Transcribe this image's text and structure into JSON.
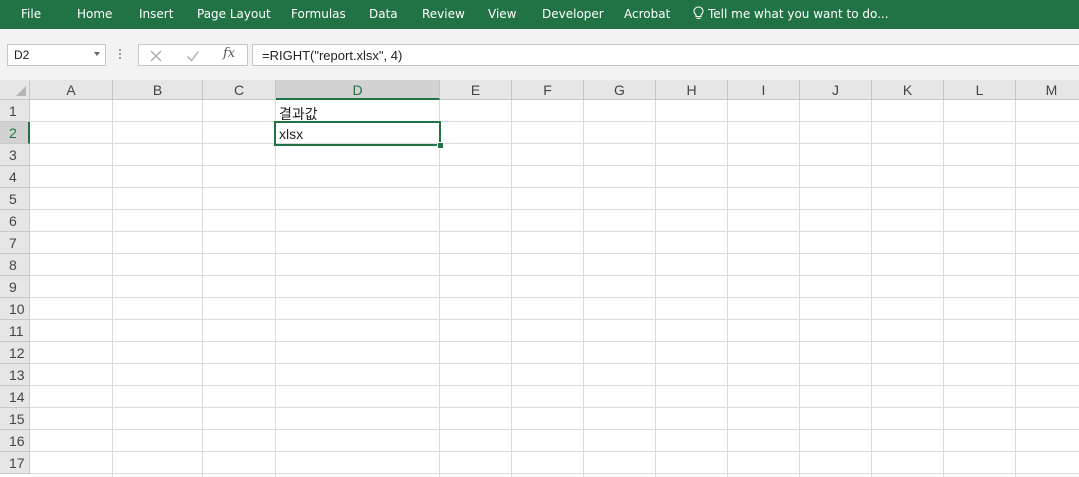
{
  "ribbon": {
    "tabs": [
      "File",
      "Home",
      "Insert",
      "Page Layout",
      "Formulas",
      "Data",
      "Review",
      "View",
      "Developer",
      "Acrobat"
    ],
    "tell_me": "Tell me what you want to do...",
    "color": "#217346"
  },
  "formula_bar": {
    "name_box": "D2",
    "formula": "=RIGHT(\"report.xlsx\", 4)",
    "fx_label": "fx",
    "icons": [
      "cancel-icon",
      "enter-icon",
      "insert-function-icon"
    ]
  },
  "grid": {
    "columns": [
      "A",
      "B",
      "C",
      "D",
      "E",
      "F",
      "G",
      "H",
      "I",
      "J",
      "K",
      "L",
      "M"
    ],
    "rows": [
      "1",
      "2",
      "3",
      "4",
      "5",
      "6",
      "7",
      "8",
      "9",
      "10",
      "11",
      "12",
      "13",
      "14",
      "15",
      "16",
      "17"
    ],
    "active_cell": "D2",
    "active_column": "D",
    "active_row": "2",
    "cells": {
      "D1": "결과값",
      "D2": "xlsx"
    }
  }
}
